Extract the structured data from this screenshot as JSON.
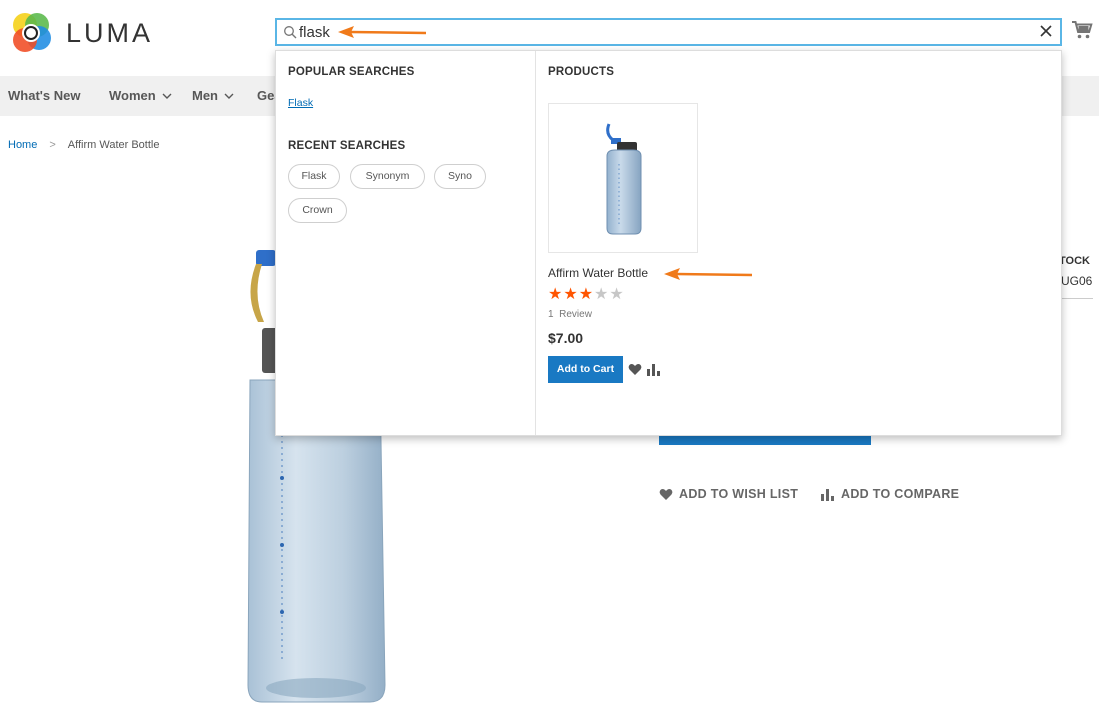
{
  "brand": {
    "name": "LUMA"
  },
  "search": {
    "value": "flask",
    "placeholder": ""
  },
  "nav": {
    "items": [
      {
        "label": "What's New",
        "has_dropdown": false
      },
      {
        "label": "Women",
        "has_dropdown": true
      },
      {
        "label": "Men",
        "has_dropdown": true
      },
      {
        "label": "Gea",
        "has_dropdown": false
      }
    ]
  },
  "breadcrumb": {
    "home": "Home",
    "separator": ">",
    "current": "Affirm Water Bottle"
  },
  "product_page": {
    "stock_label": "TOCK",
    "sku": "UG06",
    "wish_label": "ADD TO WISH LIST",
    "compare_label": "ADD TO COMPARE"
  },
  "autocomplete": {
    "popular_heading": "POPULAR SEARCHES",
    "popular_items": [
      "Flask"
    ],
    "recent_heading": "RECENT SEARCHES",
    "recent_items": [
      "Flask",
      "Synonym",
      "Syno",
      "Crown"
    ],
    "products_heading": "PRODUCTS",
    "product": {
      "name": "Affirm Water Bottle",
      "rating_stars": 3,
      "rating_max": 5,
      "review_count": "1",
      "review_label": "Review",
      "price": "$7.00",
      "add_to_cart": "Add to Cart"
    }
  },
  "icons": {
    "logo": "luma-logo-icon",
    "search": "search-icon",
    "clear": "close-icon",
    "cart": "cart-icon",
    "wishlist": "heart-icon",
    "compare": "compare-icon",
    "dropdown": "chevron-down-icon",
    "breadcrumb_separator": "chevron-right-icon",
    "annotation": "arrow-icon"
  },
  "colors": {
    "accent": "#1979c3",
    "link": "#006bb4",
    "star": "#ff5501",
    "search_border": "#5ab6e6",
    "annotation": "#f07a1a"
  }
}
